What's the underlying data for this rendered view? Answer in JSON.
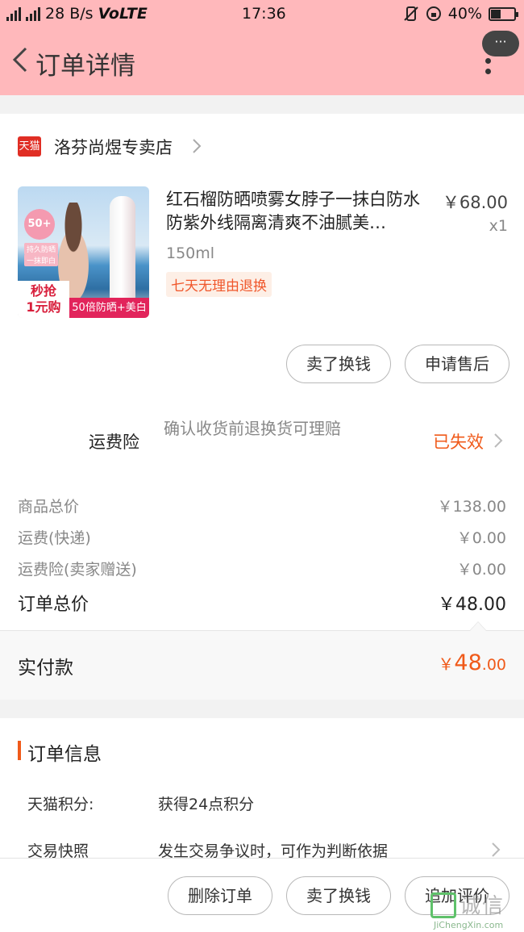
{
  "status_bar": {
    "network_small": "4G",
    "network_small2": "3G",
    "speed": "28 B/s",
    "volte": "VoLTE",
    "time": "17:36",
    "battery": "40%",
    "battery_level": 0.4
  },
  "nav": {
    "title": "订单详情",
    "more_bubble": "···"
  },
  "shop": {
    "badge": "天猫",
    "name": "洛芬尚煜专卖店"
  },
  "product": {
    "title": "红石榴防晒喷雾女脖子一抹白防水防紫外线隔离清爽不油腻美…",
    "price": "￥68.00",
    "qty": "x1",
    "spec": "150ml",
    "return_tag": "七天无理由退换",
    "image": {
      "badge": "50+",
      "tag1": "持久防晒",
      "tag2": "一抹即白",
      "promo": "秒抢\n1元购",
      "strip": "50倍防晒+美白"
    }
  },
  "actions": {
    "sell": "卖了换钱",
    "aftersale": "申请售后"
  },
  "insurance": {
    "label": "运费险",
    "desc": "确认收货前退换货可理赔",
    "status": "已失效"
  },
  "costs": [
    {
      "label": "商品总价",
      "value": "￥138.00"
    },
    {
      "label": "运费(快递)",
      "value": "￥0.00"
    },
    {
      "label": "运费险(卖家赠送)",
      "value": "￥0.00"
    }
  ],
  "total": {
    "label": "订单总价",
    "value": "￥48.00"
  },
  "paid": {
    "label": "实付款",
    "currency": "￥",
    "integer": "48",
    "decimal": ".00"
  },
  "order_info": {
    "title": "订单信息",
    "rows": [
      {
        "key": "天猫积分:",
        "value": "获得24点积分"
      },
      {
        "key": "交易快照",
        "value": "发生交易争议时，可作为判断依据"
      }
    ]
  },
  "bottom": {
    "delete": "删除订单",
    "sell": "卖了换钱",
    "review": "追加评价"
  },
  "watermark": {
    "text": "诚信",
    "url": "JiChengXin.com"
  },
  "colors": {
    "header_bg": "#ffb8bb",
    "accent": "#f05a1a",
    "tmall_red": "#e02e24"
  }
}
